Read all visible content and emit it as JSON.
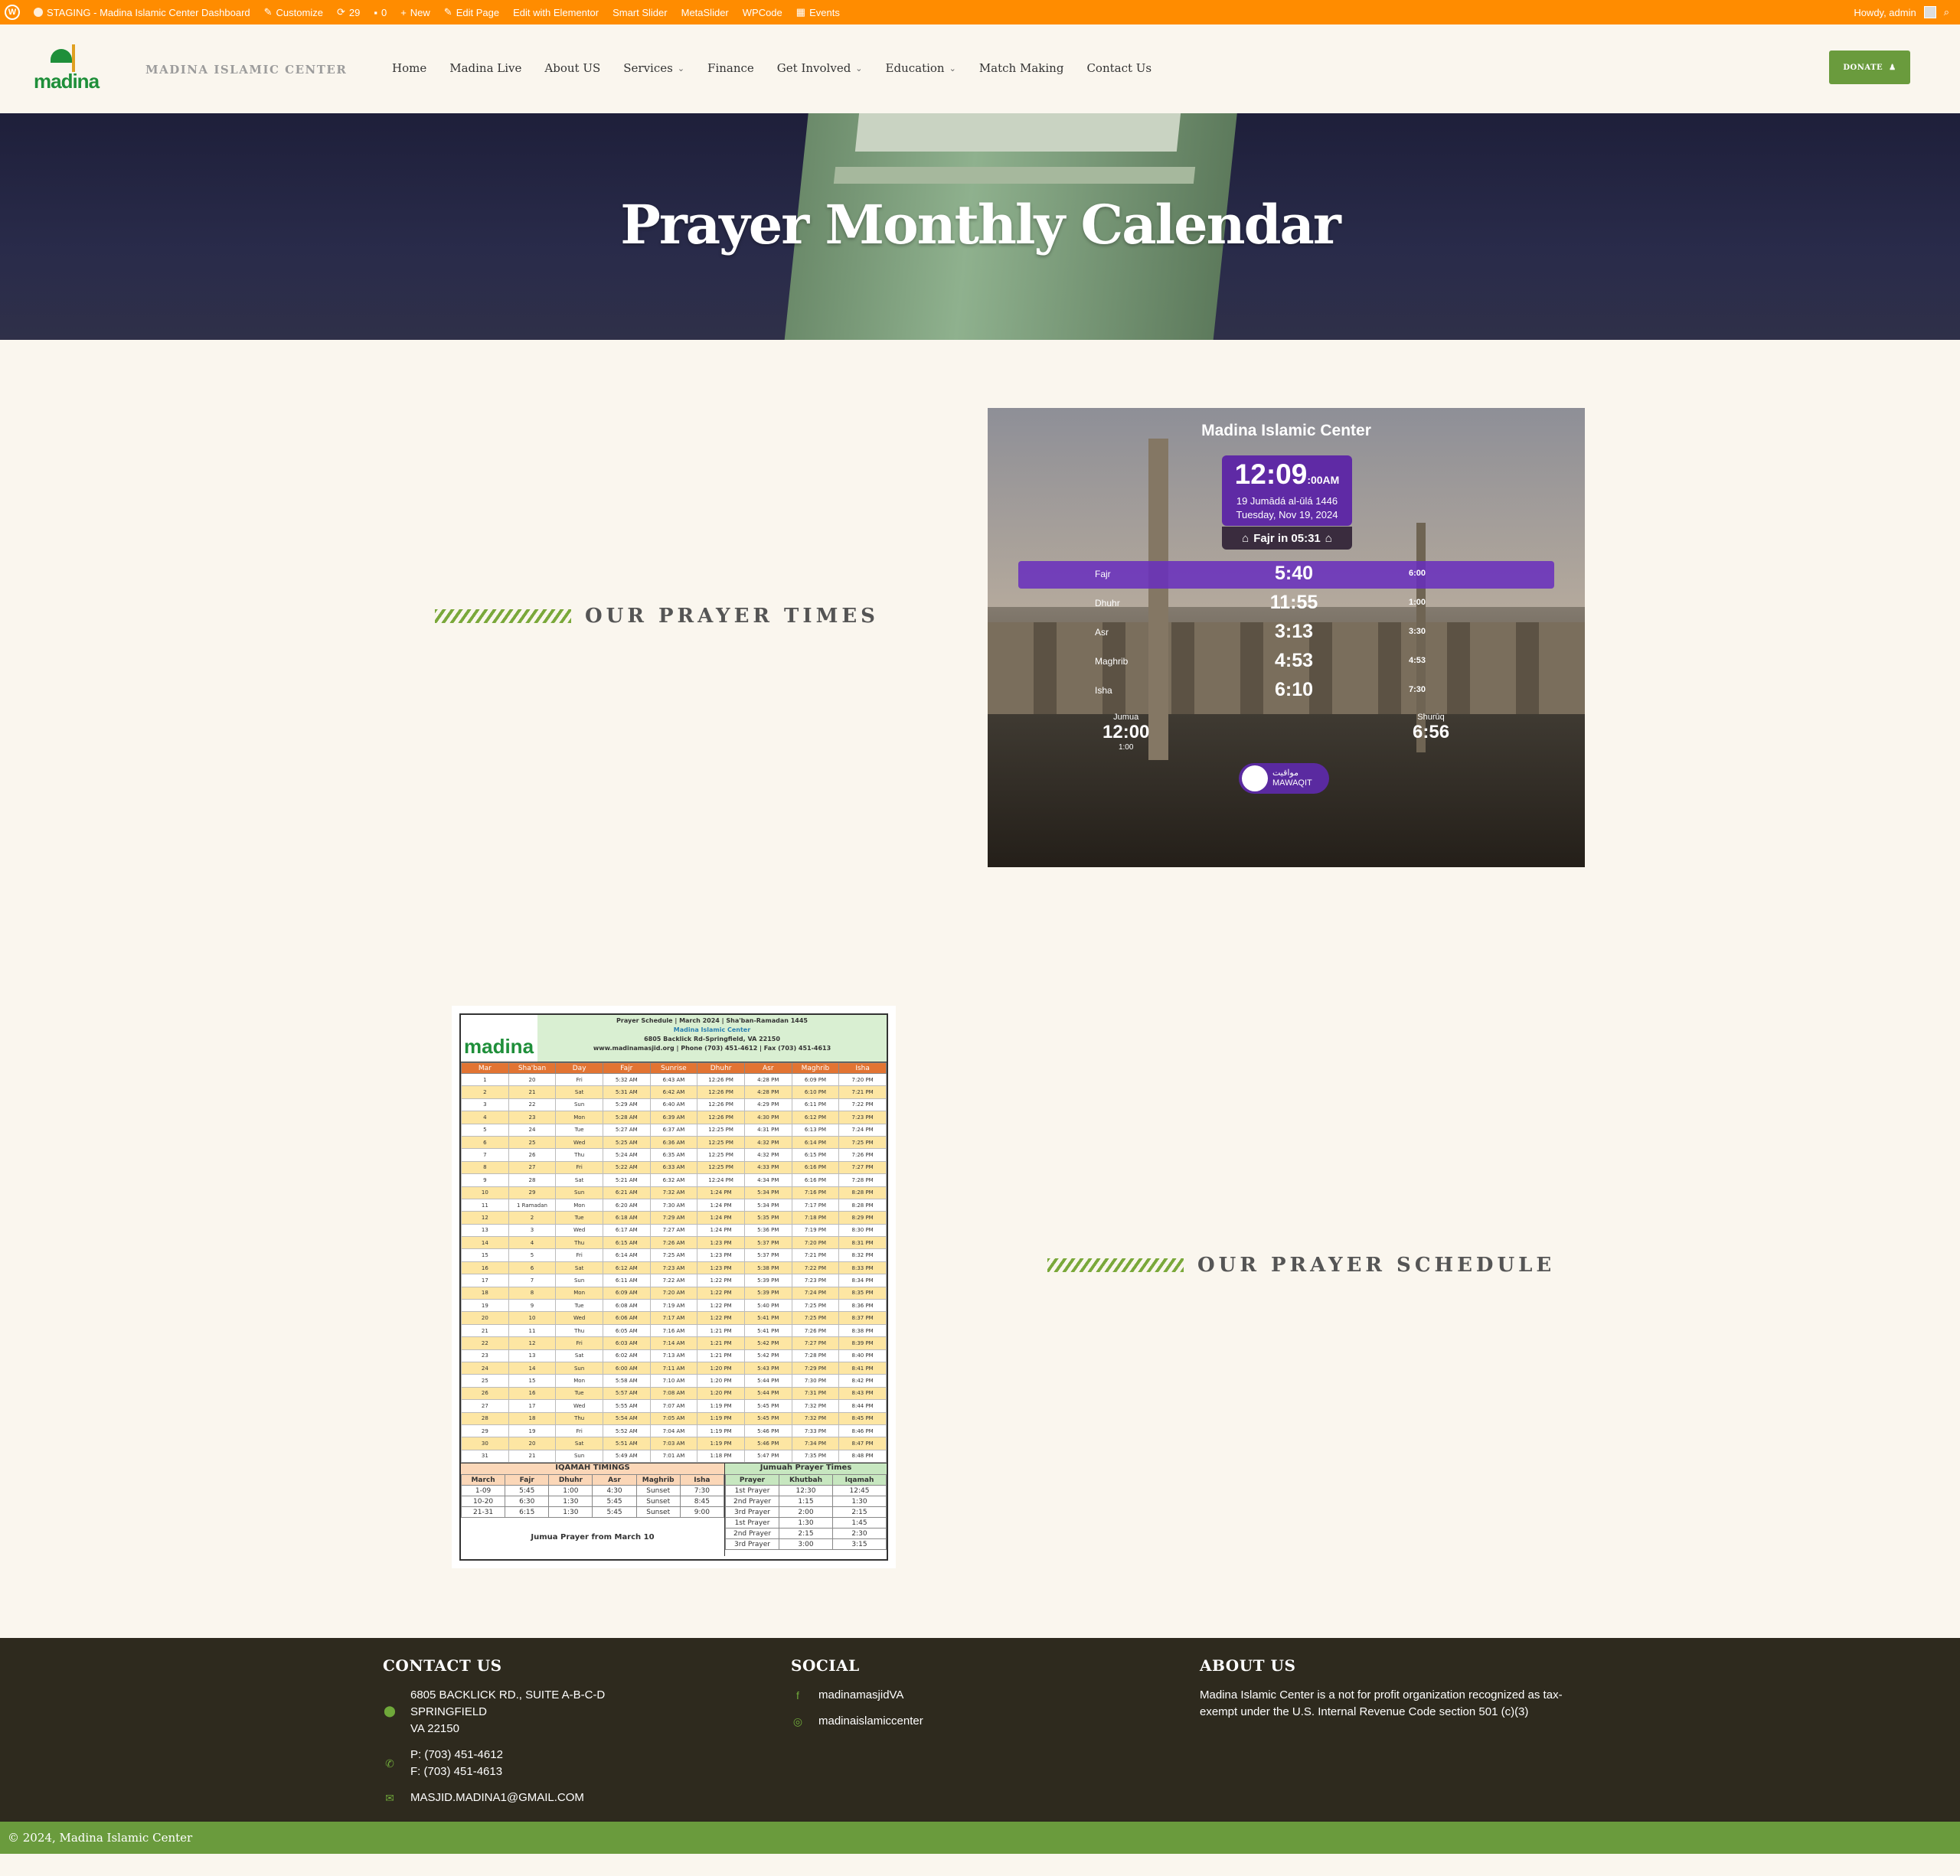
{
  "admin_bar": {
    "site": "STAGING - Madina Islamic Center Dashboard",
    "customize": "Customize",
    "updates": "29",
    "comments": "0",
    "new": "New",
    "edit_page": "Edit Page",
    "elementor": "Edit with Elementor",
    "smart_slider": "Smart Slider",
    "metaslider": "MetaSlider",
    "wpcode": "WPCode",
    "events": "Events",
    "howdy": "Howdy, admin"
  },
  "header": {
    "logo_text": "madina",
    "site_name": "MADINA ISLAMIC CENTER",
    "nav": [
      {
        "label": "Home"
      },
      {
        "label": "Madina Live"
      },
      {
        "label": "About US"
      },
      {
        "label": "Services"
      },
      {
        "label": "Finance"
      },
      {
        "label": "Get Involved"
      },
      {
        "label": "Education"
      },
      {
        "label": "Match Making"
      },
      {
        "label": "Contact Us"
      }
    ],
    "donate": "DONATE"
  },
  "hero": {
    "title": "Prayer Monthly Calendar"
  },
  "sections": {
    "prayer_times": "OUR PRAYER TIMES",
    "prayer_schedule": "OUR PRAYER SCHEDULE"
  },
  "widget": {
    "title": "Madina Islamic Center",
    "time": "12:09",
    "seconds": ":00",
    "ampm": "AM",
    "hijri": "19 Jumādá al-ūlá 1446",
    "date": "Tuesday, Nov 19, 2024",
    "next": "Fajr in 05:31",
    "prayers": [
      {
        "name": "Fajr",
        "adhan": "5:40",
        "iqamah": "6:00"
      },
      {
        "name": "Dhuhr",
        "adhan": "11:55",
        "iqamah": "1:00"
      },
      {
        "name": "Asr",
        "adhan": "3:13",
        "iqamah": "3:30"
      },
      {
        "name": "Maghrib",
        "adhan": "4:53",
        "iqamah": "4:53"
      },
      {
        "name": "Isha",
        "adhan": "6:10",
        "iqamah": "7:30"
      }
    ],
    "jumua_label": "Jumua",
    "jumua_time": "12:00",
    "jumua_iqamah": "1:00",
    "shuruq_label": "Shurūq",
    "shuruq_time": "6:56",
    "mawaqit_ar": "مواقيت",
    "mawaqit_en": "MAWAQIT"
  },
  "schedule": {
    "title": "Prayer Schedule | March 2024 | Sha'ban-Ramadan 1445",
    "center": "Madina Islamic Center",
    "address": "6805 Backlick Rd-Springfield, VA 22150",
    "contact": "www.madinamasjid.org | Phone (703) 451-4612 | Fax (703) 451-4613",
    "columns": [
      "Mar",
      "Sha'ban",
      "Day",
      "Fajr",
      "Sunrise",
      "Dhuhr",
      "Asr",
      "Maghrib",
      "Isha"
    ],
    "rows": [
      [
        "1",
        "20",
        "Fri",
        "5:32 AM",
        "6:43 AM",
        "12:26 PM",
        "4:28 PM",
        "6:09 PM",
        "7:20 PM"
      ],
      [
        "2",
        "21",
        "Sat",
        "5:31 AM",
        "6:42 AM",
        "12:26 PM",
        "4:28 PM",
        "6:10 PM",
        "7:21 PM"
      ],
      [
        "3",
        "22",
        "Sun",
        "5:29 AM",
        "6:40 AM",
        "12:26 PM",
        "4:29 PM",
        "6:11 PM",
        "7:22 PM"
      ],
      [
        "4",
        "23",
        "Mon",
        "5:28 AM",
        "6:39 AM",
        "12:26 PM",
        "4:30 PM",
        "6:12 PM",
        "7:23 PM"
      ],
      [
        "5",
        "24",
        "Tue",
        "5:27 AM",
        "6:37 AM",
        "12:25 PM",
        "4:31 PM",
        "6:13 PM",
        "7:24 PM"
      ],
      [
        "6",
        "25",
        "Wed",
        "5:25 AM",
        "6:36 AM",
        "12:25 PM",
        "4:32 PM",
        "6:14 PM",
        "7:25 PM"
      ],
      [
        "7",
        "26",
        "Thu",
        "5:24 AM",
        "6:35 AM",
        "12:25 PM",
        "4:32 PM",
        "6:15 PM",
        "7:26 PM"
      ],
      [
        "8",
        "27",
        "Fri",
        "5:22 AM",
        "6:33 AM",
        "12:25 PM",
        "4:33 PM",
        "6:16 PM",
        "7:27 PM"
      ],
      [
        "9",
        "28",
        "Sat",
        "5:21 AM",
        "6:32 AM",
        "12:24 PM",
        "4:34 PM",
        "6:16 PM",
        "7:28 PM"
      ],
      [
        "10",
        "29",
        "Sun",
        "6:21 AM",
        "7:32 AM",
        "1:24 PM",
        "5:34 PM",
        "7:16 PM",
        "8:28 PM"
      ],
      [
        "11",
        "1 Ramadan",
        "Mon",
        "6:20 AM",
        "7:30 AM",
        "1:24 PM",
        "5:34 PM",
        "7:17 PM",
        "8:28 PM"
      ],
      [
        "12",
        "2",
        "Tue",
        "6:18 AM",
        "7:29 AM",
        "1:24 PM",
        "5:35 PM",
        "7:18 PM",
        "8:29 PM"
      ],
      [
        "13",
        "3",
        "Wed",
        "6:17 AM",
        "7:27 AM",
        "1:24 PM",
        "5:36 PM",
        "7:19 PM",
        "8:30 PM"
      ],
      [
        "14",
        "4",
        "Thu",
        "6:15 AM",
        "7:26 AM",
        "1:23 PM",
        "5:37 PM",
        "7:20 PM",
        "8:31 PM"
      ],
      [
        "15",
        "5",
        "Fri",
        "6:14 AM",
        "7:25 AM",
        "1:23 PM",
        "5:37 PM",
        "7:21 PM",
        "8:32 PM"
      ],
      [
        "16",
        "6",
        "Sat",
        "6:12 AM",
        "7:23 AM",
        "1:23 PM",
        "5:38 PM",
        "7:22 PM",
        "8:33 PM"
      ],
      [
        "17",
        "7",
        "Sun",
        "6:11 AM",
        "7:22 AM",
        "1:22 PM",
        "5:39 PM",
        "7:23 PM",
        "8:34 PM"
      ],
      [
        "18",
        "8",
        "Mon",
        "6:09 AM",
        "7:20 AM",
        "1:22 PM",
        "5:39 PM",
        "7:24 PM",
        "8:35 PM"
      ],
      [
        "19",
        "9",
        "Tue",
        "6:08 AM",
        "7:19 AM",
        "1:22 PM",
        "5:40 PM",
        "7:25 PM",
        "8:36 PM"
      ],
      [
        "20",
        "10",
        "Wed",
        "6:06 AM",
        "7:17 AM",
        "1:22 PM",
        "5:41 PM",
        "7:25 PM",
        "8:37 PM"
      ],
      [
        "21",
        "11",
        "Thu",
        "6:05 AM",
        "7:16 AM",
        "1:21 PM",
        "5:41 PM",
        "7:26 PM",
        "8:38 PM"
      ],
      [
        "22",
        "12",
        "Fri",
        "6:03 AM",
        "7:14 AM",
        "1:21 PM",
        "5:42 PM",
        "7:27 PM",
        "8:39 PM"
      ],
      [
        "23",
        "13",
        "Sat",
        "6:02 AM",
        "7:13 AM",
        "1:21 PM",
        "5:42 PM",
        "7:28 PM",
        "8:40 PM"
      ],
      [
        "24",
        "14",
        "Sun",
        "6:00 AM",
        "7:11 AM",
        "1:20 PM",
        "5:43 PM",
        "7:29 PM",
        "8:41 PM"
      ],
      [
        "25",
        "15",
        "Mon",
        "5:58 AM",
        "7:10 AM",
        "1:20 PM",
        "5:44 PM",
        "7:30 PM",
        "8:42 PM"
      ],
      [
        "26",
        "16",
        "Tue",
        "5:57 AM",
        "7:08 AM",
        "1:20 PM",
        "5:44 PM",
        "7:31 PM",
        "8:43 PM"
      ],
      [
        "27",
        "17",
        "Wed",
        "5:55 AM",
        "7:07 AM",
        "1:19 PM",
        "5:45 PM",
        "7:32 PM",
        "8:44 PM"
      ],
      [
        "28",
        "18",
        "Thu",
        "5:54 AM",
        "7:05 AM",
        "1:19 PM",
        "5:45 PM",
        "7:32 PM",
        "8:45 PM"
      ],
      [
        "29",
        "19",
        "Fri",
        "5:52 AM",
        "7:04 AM",
        "1:19 PM",
        "5:46 PM",
        "7:33 PM",
        "8:46 PM"
      ],
      [
        "30",
        "20",
        "Sat",
        "5:51 AM",
        "7:03 AM",
        "1:19 PM",
        "5:46 PM",
        "7:34 PM",
        "8:47 PM"
      ],
      [
        "31",
        "21",
        "Sun",
        "5:49 AM",
        "7:01 AM",
        "1:18 PM",
        "5:47 PM",
        "7:35 PM",
        "8:48 PM"
      ]
    ],
    "iqamah_title": "IQAMAH TIMINGS",
    "iqamah_cols": [
      "March",
      "Fajr",
      "Dhuhr",
      "Asr",
      "Maghrib",
      "Isha"
    ],
    "iqamah_rows": [
      [
        "1-09",
        "5:45",
        "1:00",
        "4:30",
        "Sunset",
        "7:30"
      ],
      [
        "10-20",
        "6:30",
        "1:30",
        "5:45",
        "Sunset",
        "8:45"
      ],
      [
        "21-31",
        "6:15",
        "1:30",
        "5:45",
        "Sunset",
        "9:00"
      ]
    ],
    "jumuah_title": "Jumuah Prayer Times",
    "jumuah_cols": [
      "Prayer",
      "Khutbah",
      "Iqamah"
    ],
    "jumuah_rows": [
      [
        "1st Prayer",
        "12:30",
        "12:45"
      ],
      [
        "2nd Prayer",
        "1:15",
        "1:30"
      ],
      [
        "3rd Prayer",
        "2:00",
        "2:15"
      ],
      [
        "1st Prayer",
        "1:30",
        "1:45"
      ],
      [
        "2nd Prayer",
        "2:15",
        "2:30"
      ],
      [
        "3rd Prayer",
        "3:00",
        "3:15"
      ]
    ],
    "jumua_note": "Jumua Prayer from March 10"
  },
  "footer": {
    "contact_title": "CONTACT US",
    "address1": "6805 BACKLICK RD., SUITE A-B-C-D",
    "address2": "SPRINGFIELD",
    "address3": "VA 22150",
    "phone": "P: (703) 451-4612",
    "fax": "F: (703) 451-4613",
    "email": "MASJID.MADINA1@GMAIL.COM",
    "social_title": "SOCIAL",
    "facebook": "madinamasjidVA",
    "instagram": "madinaislamiccenter",
    "about_title": "ABOUT US",
    "about_text": "Madina Islamic Center is a not for profit organization recognized as tax-exempt under the U.S. Internal Revenue Code section 501 (c)(3)",
    "copyright": "© 2024, Madina Islamic Center"
  },
  "colors": {
    "admin_bar": "#ff8c00",
    "accent_green": "#6a9b3d",
    "widget_purple": "#5f2aa5",
    "footer_bg": "#2e2a1e"
  }
}
